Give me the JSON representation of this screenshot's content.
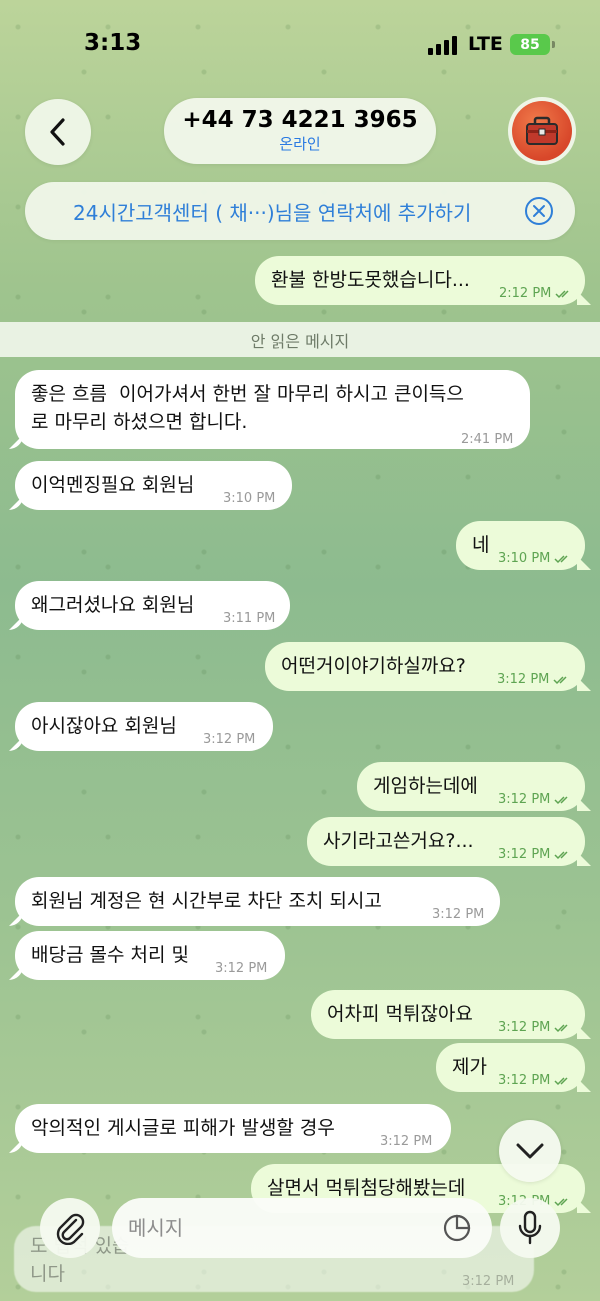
{
  "status_bar": {
    "time": "3:13",
    "network": "LTE",
    "battery": "85"
  },
  "header": {
    "phone": "+44 73 4221 3965",
    "status": "온라인"
  },
  "add_contact_banner": {
    "text": "24시간고객센터 ( 채···)님을 연락처에 추가하기"
  },
  "unread_divider": "안 읽은 메시지",
  "messages": [
    {
      "dir": "out",
      "text": "환불 한방도못했습니다...",
      "time": "2:12 PM"
    },
    {
      "dir": "in",
      "text": "좋은 흐름  이어가셔서 한번 잘 마무리 하시고 큰이득으\n로 마무리 하셨으면 합니다.",
      "time": "2:41 PM"
    },
    {
      "dir": "in",
      "text": "이억멘징필요 회원님",
      "time": "3:10 PM"
    },
    {
      "dir": "out",
      "text": "네",
      "time": "3:10 PM"
    },
    {
      "dir": "in",
      "text": "왜그러셨나요 회원님",
      "time": "3:11 PM"
    },
    {
      "dir": "out",
      "text": "어떤거이야기하실까요?",
      "time": "3:12 PM"
    },
    {
      "dir": "in",
      "text": "아시잖아요 회원님",
      "time": "3:12 PM"
    },
    {
      "dir": "out",
      "text": "게임하는데에",
      "time": "3:12 PM"
    },
    {
      "dir": "out",
      "text": "사기라고쓴거요?...",
      "time": "3:12 PM"
    },
    {
      "dir": "in",
      "text": "회원님 계정은 현 시간부로 차단 조치 되시고",
      "time": "3:12 PM"
    },
    {
      "dir": "in",
      "text": "배당금 몰수 처리 및",
      "time": "3:12 PM"
    },
    {
      "dir": "out",
      "text": "어차피 먹튀잖아요",
      "time": "3:12 PM"
    },
    {
      "dir": "out",
      "text": "제가",
      "time": "3:12 PM"
    },
    {
      "dir": "in",
      "text": "악의적인 게시글로 피해가 발생할 경우",
      "time": "3:12 PM"
    },
    {
      "dir": "out",
      "text": "살면서 먹튀첨당해봤는데",
      "time": "3:12 PM"
    }
  ],
  "faded_message": {
    "text": "도 법적 있습\n니다",
    "time": "3:12 PM"
  },
  "input": {
    "placeholder": "메시지"
  },
  "icons": [
    "back-chevron-icon",
    "toolbox-avatar-icon",
    "close-icon",
    "double-check-icon",
    "chevron-down-icon",
    "paperclip-icon",
    "sticker-icon",
    "microphone-icon"
  ],
  "colors": {
    "accent": "#2f7fd8",
    "out_bubble": "#ecfbd9",
    "in_bubble": "#ffffff",
    "read_check": "#5ea452"
  }
}
